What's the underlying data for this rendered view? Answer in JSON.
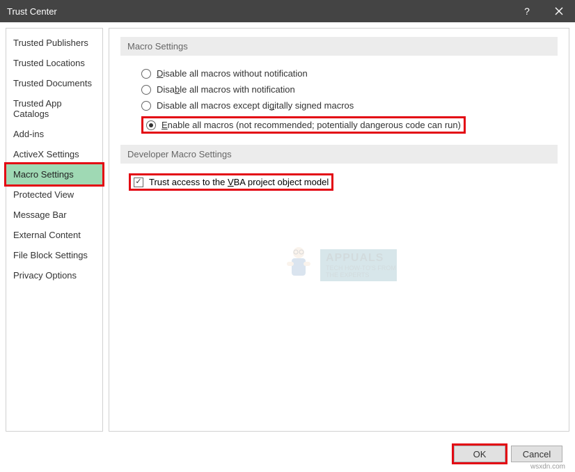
{
  "window": {
    "title": "Trust Center"
  },
  "sidebar": {
    "items": [
      {
        "label": "Trusted Publishers",
        "selected": false
      },
      {
        "label": "Trusted Locations",
        "selected": false
      },
      {
        "label": "Trusted Documents",
        "selected": false
      },
      {
        "label": "Trusted App Catalogs",
        "selected": false
      },
      {
        "label": "Add-ins",
        "selected": false
      },
      {
        "label": "ActiveX Settings",
        "selected": false
      },
      {
        "label": "Macro Settings",
        "selected": true
      },
      {
        "label": "Protected View",
        "selected": false
      },
      {
        "label": "Message Bar",
        "selected": false
      },
      {
        "label": "External Content",
        "selected": false
      },
      {
        "label": "File Block Settings",
        "selected": false
      },
      {
        "label": "Privacy Options",
        "selected": false
      }
    ]
  },
  "sections": {
    "macro_header": "Macro Settings",
    "dev_header": "Developer Macro Settings"
  },
  "macro_settings": {
    "options": [
      {
        "pre": "",
        "u": "D",
        "post": "isable all macros without notification",
        "selected": false
      },
      {
        "pre": "Disa",
        "u": "b",
        "post": "le all macros with notification",
        "selected": false
      },
      {
        "pre": "Disable all macros except di",
        "u": "g",
        "post": "itally signed macros",
        "selected": false
      },
      {
        "pre": "",
        "u": "E",
        "post": "nable all macros (not recommended; potentially dangerous code can run)",
        "selected": true
      }
    ]
  },
  "dev_settings": {
    "checkbox": {
      "pre": "Trust access to the ",
      "u": "V",
      "post": "BA project object model",
      "checked": true
    }
  },
  "buttons": {
    "ok": "OK",
    "cancel": "Cancel"
  },
  "watermark": {
    "site": "wsxdn.com",
    "brand": "APPUALS",
    "tagline": "TECH HOW-TO'S FROM THE EXPERTS"
  }
}
